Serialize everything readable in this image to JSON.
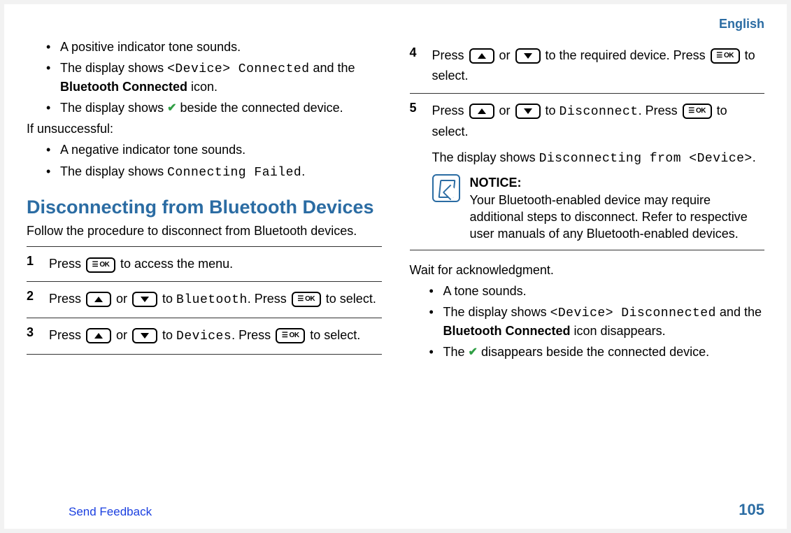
{
  "header": {
    "language": "English"
  },
  "left": {
    "bullets_top": [
      {
        "pre": "A positive indicator tone sounds."
      },
      {
        "pre": "The display shows ",
        "mono": "<Device> Connected",
        "mid": " and the ",
        "bold": "Bluetooth Connected",
        "post": " icon."
      },
      {
        "pre": "The display shows ",
        "check": true,
        "post": " beside the connected device."
      }
    ],
    "if_unsuccessful": "If unsuccessful:",
    "bullets_fail": [
      {
        "pre": "A negative indicator tone sounds."
      },
      {
        "pre": "The display shows ",
        "mono": "Connecting Failed",
        "post": "."
      }
    ],
    "section_title": "Disconnecting from Bluetooth Devices",
    "section_sub": "Follow the procedure to disconnect from Bluetooth devices.",
    "steps": [
      {
        "num": "1",
        "t1": "Press ",
        "k1": "ok",
        "t2": " to access the menu."
      },
      {
        "num": "2",
        "t1": "Press ",
        "k1": "up",
        "t2": " or ",
        "k2": "down",
        "t3": " to ",
        "mono": "Bluetooth",
        "t4": ". Press ",
        "k3": "ok",
        "t5": " to select."
      },
      {
        "num": "3",
        "t1": "Press ",
        "k1": "up",
        "t2": " or ",
        "k2": "down",
        "t3": " to ",
        "mono": "Devices",
        "t4": ". Press ",
        "k3": "ok",
        "t5": " to select."
      }
    ]
  },
  "right": {
    "steps": [
      {
        "num": "4",
        "t1": "Press ",
        "k1": "up",
        "t2": " or ",
        "k2": "down",
        "t3": " to the required device. Press ",
        "k3": "ok",
        "t4": " to select."
      },
      {
        "num": "5",
        "t1": "Press ",
        "k1": "up",
        "t2": " or ",
        "k2": "down",
        "t3": " to ",
        "mono": "Disconnect",
        "t4": ". Press ",
        "k3": "ok",
        "t5": " to select.",
        "after_p_pre": "The display shows ",
        "after_mono": "Disconnecting from <Device>",
        "after_post": ".",
        "notice_title": "NOTICE:",
        "notice_body": "Your Bluetooth-enabled device may require additional steps to disconnect. Refer to respective user manuals of any Bluetooth-enabled devices."
      }
    ],
    "wait": "Wait for acknowledgment.",
    "bullets_end": [
      {
        "pre": "A tone sounds."
      },
      {
        "pre": "The display shows ",
        "mono": "<Device> Disconnected",
        "mid": " and the ",
        "bold": "Bluetooth Connected",
        "post": " icon disappears."
      },
      {
        "pre": "The ",
        "check": true,
        "post": " disappears beside the connected device."
      }
    ]
  },
  "footer": {
    "feedback": "Send Feedback",
    "page": "105"
  }
}
